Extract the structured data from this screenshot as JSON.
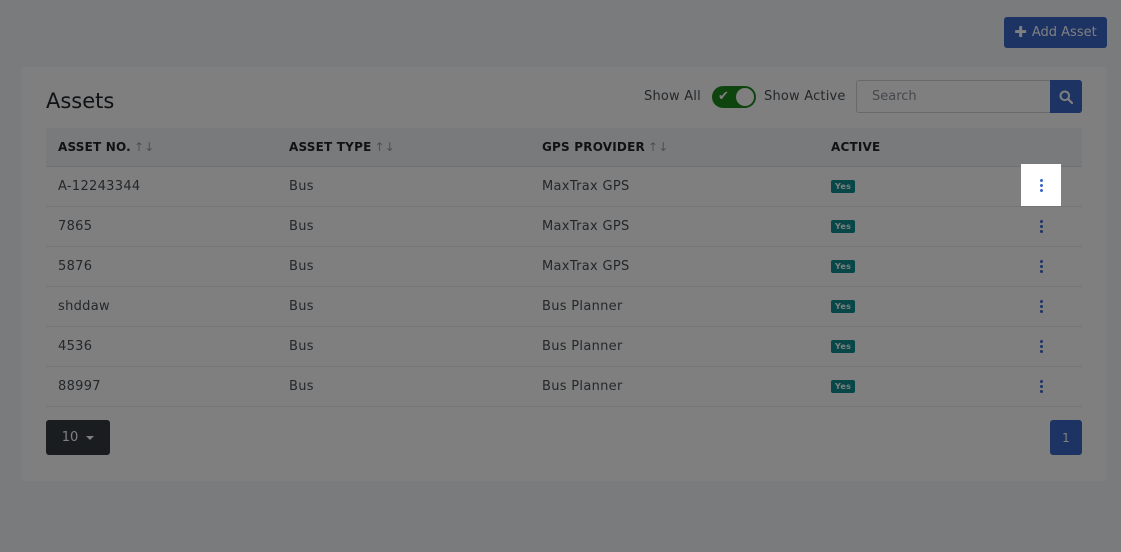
{
  "header": {
    "add_button_label": "Add Asset"
  },
  "card": {
    "title": "Assets",
    "toggle": {
      "left_label": "Show All",
      "right_label": "Show Active",
      "checked": true
    },
    "search": {
      "placeholder": "Search",
      "value": ""
    }
  },
  "table": {
    "columns": [
      {
        "label": "ASSET NO.",
        "sortable": true
      },
      {
        "label": "ASSET TYPE",
        "sortable": true
      },
      {
        "label": "GPS PROVIDER",
        "sortable": true
      },
      {
        "label": "ACTIVE",
        "sortable": false
      }
    ],
    "sort_glyph": "↑↓",
    "rows": [
      {
        "asset_no": "A-12243344",
        "asset_type": "Bus",
        "gps_provider": "MaxTrax GPS",
        "active": "Yes"
      },
      {
        "asset_no": "7865",
        "asset_type": "Bus",
        "gps_provider": "MaxTrax GPS",
        "active": "Yes"
      },
      {
        "asset_no": "5876",
        "asset_type": "Bus",
        "gps_provider": "MaxTrax GPS",
        "active": "Yes"
      },
      {
        "asset_no": "shddaw",
        "asset_type": "Bus",
        "gps_provider": "Bus Planner",
        "active": "Yes"
      },
      {
        "asset_no": "4536",
        "asset_type": "Bus",
        "gps_provider": "Bus Planner",
        "active": "Yes"
      },
      {
        "asset_no": "88997",
        "asset_type": "Bus",
        "gps_provider": "Bus Planner",
        "active": "Yes"
      }
    ]
  },
  "footer": {
    "page_size": "10",
    "current_page": "1"
  },
  "icons": {
    "add": "plus-icon",
    "search": "search-icon",
    "row_menu": "kebab-menu-icon",
    "toggle_check": "check-icon",
    "dropdown": "caret-down-icon"
  },
  "colors": {
    "primary": "#3a66c9",
    "toggle_on": "#1c8a1c",
    "badge": "#0f8f8f",
    "dark_button": "#343a40"
  }
}
